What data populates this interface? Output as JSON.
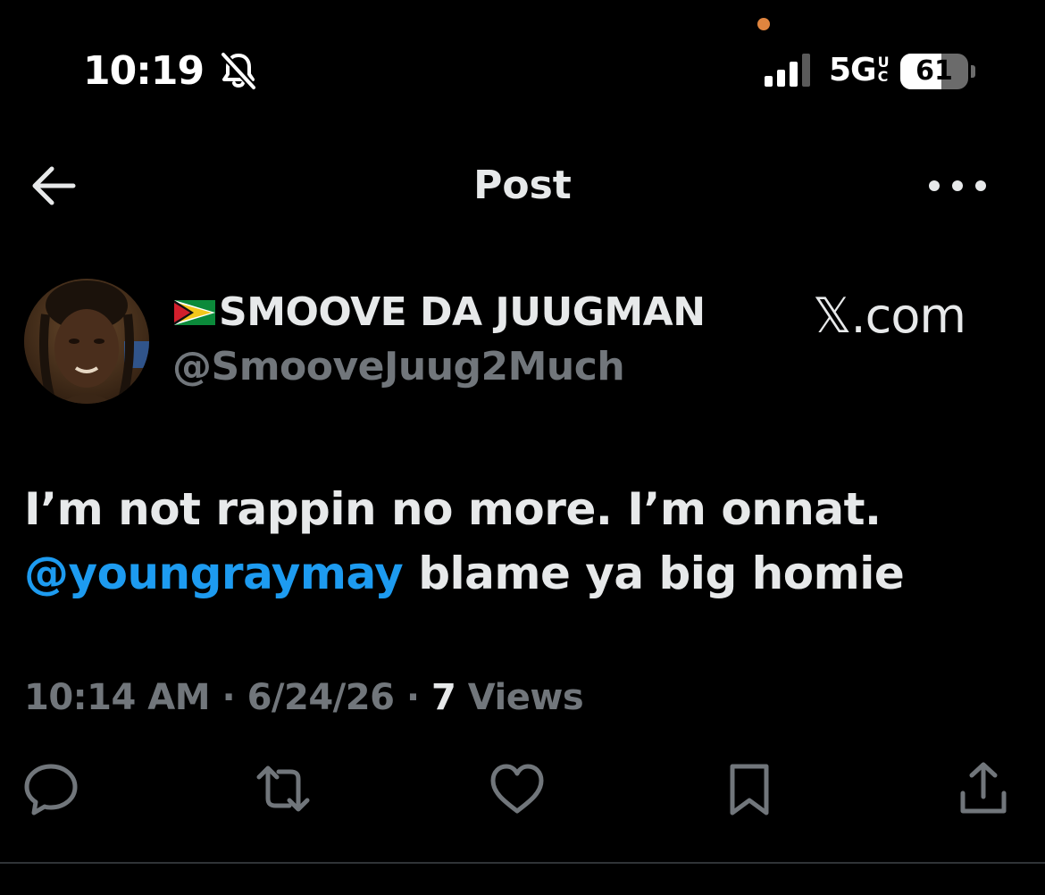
{
  "status_bar": {
    "time": "10:19",
    "network": "5G",
    "network_suffix": "UC",
    "battery_level": "61",
    "battery_fraction": 0.61,
    "icons": [
      "bell-slash-icon",
      "signal-bars-icon",
      "battery-icon"
    ]
  },
  "header": {
    "title": "Post",
    "back_icon": "arrow-left-icon",
    "more_icon": "ellipsis-icon"
  },
  "author": {
    "flag_icon": "guyana-flag-icon",
    "display_name": "SMOOVE DA JUUGMAN",
    "handle": "@SmooveJuug2Much"
  },
  "watermark": {
    "text": "𝕏.com"
  },
  "post": {
    "text_line1": "I’m not rappin no more. I’m onnat.",
    "mention": "@youngraymay",
    "text_line2_rest": " blame ya big homie"
  },
  "meta": {
    "time": "10:14 AM",
    "sep1": " · ",
    "date": "6/24/26",
    "sep2": " · ",
    "views_count": "7",
    "views_label": " Views"
  },
  "actions": {
    "icons": [
      "reply-icon",
      "repost-icon",
      "like-icon",
      "bookmark-icon",
      "share-icon"
    ]
  },
  "colors": {
    "background": "#000000",
    "text_primary": "#e7e9ea",
    "text_secondary": "#71767b",
    "accent": "#1d9bf0",
    "indicator_dot": "#e0853f"
  }
}
